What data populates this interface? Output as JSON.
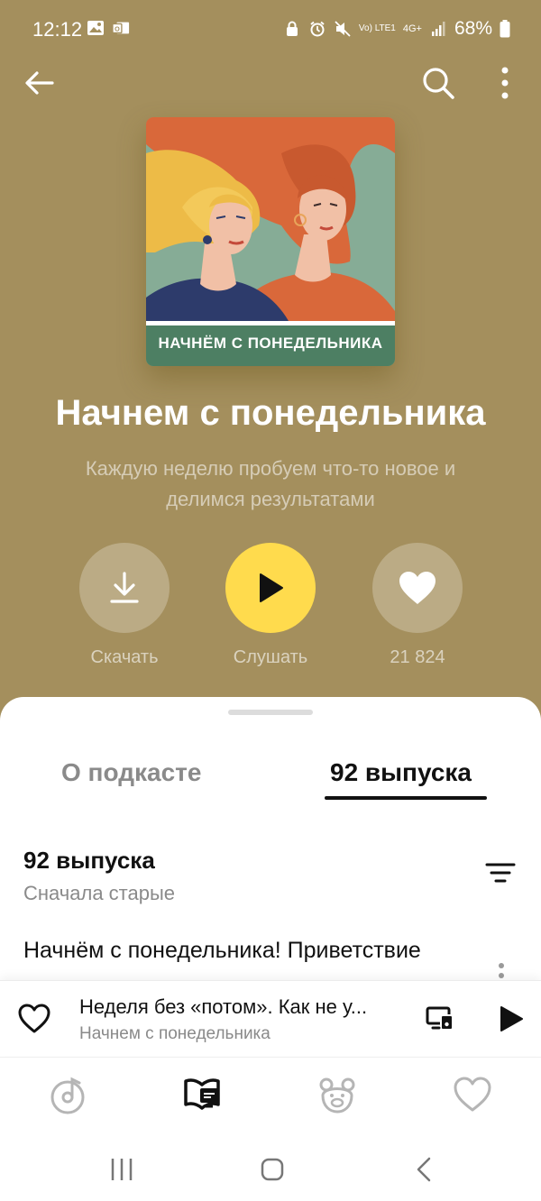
{
  "status_bar": {
    "time": "12:12",
    "battery": "68%",
    "network": "4G+",
    "volte": "Vo) LTE1"
  },
  "topbar": {
    "back_icon": "arrow-left-icon",
    "search_icon": "search-icon",
    "more_icon": "more-vertical-icon"
  },
  "podcast": {
    "cover_text": "НАЧНЁМ С ПОНЕДЕЛЬНИКА",
    "title": "Начнем с понедельника",
    "description": "Каждую неделю пробуем что-то новое и делимся результатами"
  },
  "actions": {
    "download_label": "Скачать",
    "listen_label": "Слушать",
    "likes_label": "21 824"
  },
  "tabs": {
    "about": "О подкасте",
    "episodes": "92 выпуска",
    "active": "episodes"
  },
  "episodes": {
    "count_label": "92 выпуска",
    "sort_label": "Сначала старые",
    "first_title": "Начнём с понедельника! Приветствие"
  },
  "mini_player": {
    "title": "Неделя без «потом». Как не у...",
    "subtitle": "Начнем с понедельника"
  },
  "colors": {
    "header_bg": "#a48f5d",
    "play_accent": "#ffdb4d",
    "text_primary": "#111111",
    "text_secondary": "#8a8a8a"
  }
}
